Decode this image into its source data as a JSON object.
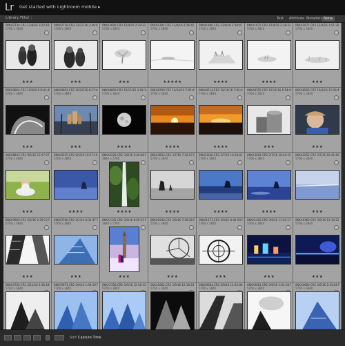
{
  "app": {
    "logo": "Lr",
    "mobile_text": "Get started with Lightroom mobile",
    "mobile_arrow": "▸"
  },
  "filter": {
    "title": "Library Filter :",
    "options": [
      {
        "label": "Text",
        "active": false
      },
      {
        "label": "Attribute",
        "active": false
      },
      {
        "label": "Metadata",
        "active": false
      },
      {
        "label": "None",
        "active": true
      }
    ]
  },
  "rows": [
    {
      "cells": [
        {
          "file": "0KKA2734.CR2",
          "date": "12/4/16 3:22:18 PM",
          "dims": "5760 x 3840",
          "stars": "★★★",
          "thumb": "bw-mother-child"
        },
        {
          "file": "0KKA2718.CR2",
          "date": "12/27/16 3:39:02 PM",
          "dims": "5760 x 3840",
          "stars": "★★★",
          "thumb": "bw-family"
        },
        {
          "file": "0KKA3606.CR2",
          "date": "12/4/16 2:29:32 PM",
          "dims": "5760 x 3840",
          "stars": "★★★",
          "thumb": "white-tree"
        },
        {
          "file": "0KKA1395.CR2",
          "date": "12/4/16 2:26:42 PM",
          "dims": "5760 x 3840",
          "stars": "★★★★★",
          "thumb": "white-snow"
        },
        {
          "file": "0KKA1986.CR2",
          "date": "12/4/16 2:19:47 PM",
          "dims": "5760 x 3840",
          "stars": "★★★★",
          "thumb": "white-hill"
        },
        {
          "file": "0KKA1975.CR2",
          "date": "12/4/16 2:18:22 PM",
          "dims": "5760 x 3840",
          "stars": "★★★★",
          "thumb": "white-trees"
        },
        {
          "file": "0KKA1971.CR2",
          "date": "12/4/16 1:51:36 PM",
          "dims": "5760 x 3840",
          "stars": "★★★",
          "thumb": "white-mist"
        }
      ]
    },
    {
      "cells": [
        {
          "file": "0KKA9964.CR2",
          "date": "10/28/16 8:41:42 PM",
          "dims": "5760 x 3840",
          "stars": "★★★",
          "thumb": "bw-building"
        },
        {
          "file": "0KKA9882.CR2",
          "date": "10/28/16 8:27:41 PM",
          "dims": "5760 x 3840",
          "stars": "★★★",
          "thumb": "city-palms"
        },
        {
          "file": "0KKA8809.CR2",
          "date": "10/15/16 3:18:18 AM",
          "dims": "5760 x 3840",
          "stars": "★★★★",
          "thumb": "moon"
        },
        {
          "file": "0KKA8709.CR2",
          "date": "10/14/16 7:05:42 AM",
          "dims": "5760 x 3840",
          "stars": "★★★★",
          "thumb": "sunrise"
        },
        {
          "file": "0KKA8714.CR2",
          "date": "10/14/16 7:05:43 AM",
          "dims": "5760 x 3840",
          "stars": "★★★★",
          "thumb": "sunrise-wide"
        },
        {
          "file": "0KKA8705.CR2",
          "date": "10/14/16 6:54:48 AM",
          "dims": "5760 x 3840",
          "stars": "★★★",
          "thumb": "silos"
        },
        {
          "file": "0KKA8583.CR2",
          "date": "10/4/16 12:20:41 PM",
          "dims": "5760 x 3840",
          "stars": "★★★",
          "thumb": "boy-portrait"
        }
      ]
    },
    {
      "cells": [
        {
          "file": "0KKA8833.CR2",
          "date": "9/5/16 12:07:27 PM",
          "dims": "5760 x 3840",
          "stars": "★★★",
          "thumb": "baby-grass"
        },
        {
          "file": "0KKA4225.CR2",
          "date": "9/5/16 10:57:19 PM",
          "dims": "5760 x 3840",
          "stars": "★★★★",
          "thumb": "blue-rock"
        },
        {
          "file": "0KKA4226.CR2",
          "date": "3/8/16 2:49:48 PM",
          "dims": "3840 x 5760",
          "stars": "★★★★",
          "thumb": "waterfall"
        },
        {
          "file": "0KKA3832.CR2",
          "date": "3/7/16 7:20:07 PM",
          "dims": "5760 x 3840",
          "stars": "★★★★",
          "thumb": "bw-rocks"
        },
        {
          "file": "0KKA3356.CR2",
          "date": "3/7/16 10:58:41 PM",
          "dims": "5760 x 3840",
          "stars": "★★★★",
          "thumb": "haystack"
        },
        {
          "file": "0KKA3261.CR2",
          "date": "3/7/16 10:44:15 PM",
          "dims": "5760 x 3840",
          "stars": "★★★★",
          "thumb": "haystack-dusk"
        },
        {
          "file": "0KKA3252.CR2",
          "date": "3/7/16 10:41:56 PM",
          "dims": "5760 x 3840",
          "stars": "★★★",
          "thumb": "blue-beach"
        }
      ]
    },
    {
      "cells": [
        {
          "file": "0KKA3969.CR2",
          "date": "5/5/16 2:39:13 PM",
          "dims": "5760 x 3840",
          "stars": "★★★",
          "thumb": "bw-towers"
        },
        {
          "file": "0KKA3780.CR2",
          "date": "4/1/16 8:33:47 PM",
          "dims": "5760 x 3840",
          "stars": "★★★",
          "thumb": "blue-building"
        },
        {
          "file": "0KKA1341.CR2",
          "date": "3/9/16 6:09:15 PM",
          "dims": "3840 x 5760",
          "stars": "★★★",
          "thumb": "bigben"
        },
        {
          "file": "0KKA1540.CR2",
          "date": "3/9/16 7:38:38 PM",
          "dims": "5760 x 3840",
          "stars": "★★★",
          "thumb": "ferris-bw"
        },
        {
          "file": "0KKA1573.CR2",
          "date": "3/9/16 8:40:50 PM",
          "dims": "5760 x 3840",
          "stars": "★★★",
          "thumb": "ferris-close"
        },
        {
          "file": "0KKA1426.CR2",
          "date": "3/9/16 11:01:17 PM",
          "dims": "5760 x 3840",
          "stars": "★★★",
          "thumb": "night-city"
        },
        {
          "file": "0KKA1369.CR2",
          "date": "3/9/16 11:10:22 PM",
          "dims": "5760 x 3840",
          "stars": "★★★",
          "thumb": "night-river"
        }
      ]
    },
    {
      "cells": [
        {
          "file": "0KKA3702.CR2",
          "date": "3/11/16 2:36:18 PM",
          "dims": "5760 x 3840",
          "stars": "",
          "thumb": "bw-peaks"
        },
        {
          "file": "0KKA3971.CR2",
          "date": "3/9/16 1:04:19 PM",
          "dims": "5760 x 3840",
          "stars": "",
          "thumb": "blue-peaks"
        },
        {
          "file": "0KKA1358.CR2",
          "date": "3/9/16 12:16:33 PM",
          "dims": "5760 x 3840",
          "stars": "",
          "thumb": "blue-peaks2"
        },
        {
          "file": "0KKA2082.CR2",
          "date": "3/9/16 12:18:23 PM",
          "dims": "5760 x 3840",
          "stars": "",
          "thumb": "bw-arch"
        },
        {
          "file": "0KKA0084.CR2",
          "date": "3/9/16 12:02:08 PM",
          "dims": "5760 x 3840",
          "stars": "",
          "thumb": "bw-angle"
        },
        {
          "file": "0KKA0081.CR2",
          "date": "3/9/16 1:01:18 PM",
          "dims": "5760 x 3840",
          "stars": "",
          "thumb": "bw-sky"
        },
        {
          "file": "0KKA0080.CR2",
          "date": "3/9/16 2:43:08 PM",
          "dims": "5760 x 3840",
          "stars": "",
          "thumb": "blue-geo"
        }
      ]
    }
  ],
  "bottombar": {
    "sort_label": "Sort :",
    "sort_value": "Capture Time"
  }
}
